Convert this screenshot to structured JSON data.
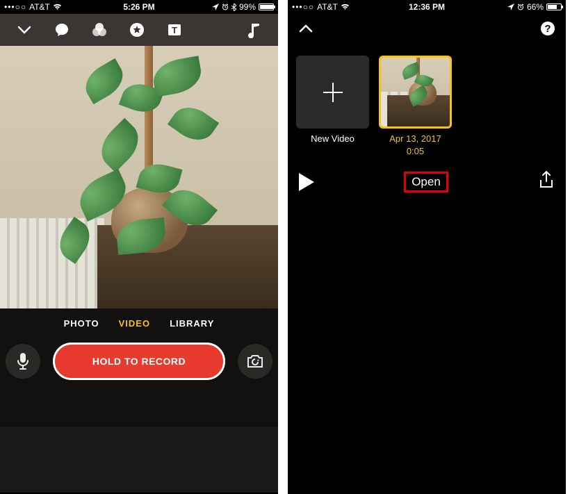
{
  "left": {
    "status": {
      "carrier": "AT&T",
      "time": "5:26 PM",
      "battery_pct": "99%",
      "signal_dots": "•••○○"
    },
    "modes": {
      "photo": "PHOTO",
      "video": "VIDEO",
      "library": "LIBRARY",
      "active": "video"
    },
    "record_label": "HOLD TO RECORD"
  },
  "right": {
    "status": {
      "carrier": "AT&T",
      "time": "12:36 PM",
      "battery_pct": "66%",
      "signal_dots": "•••○○"
    },
    "thumbs": {
      "new_label": "New Video",
      "selected_date": "Apr 13, 2017",
      "selected_duration": "0:05"
    },
    "open_label": "Open"
  }
}
